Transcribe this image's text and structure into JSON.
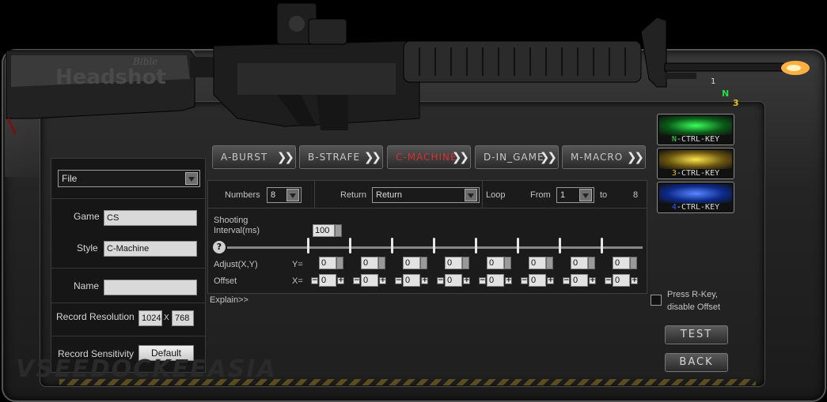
{
  "brand": {
    "stock_text": "Headshot",
    "stock_signature": "Bible",
    "watermark": "VSEEDOCKEEASIA"
  },
  "left": {
    "profile_dropdown": "File",
    "game_label": "Game",
    "game_value": "CS",
    "style_label": "Style",
    "style_value": "C-Machine",
    "name_label": "Name",
    "name_value": "",
    "resolution_label": "Record Resolution",
    "res_w": "1024",
    "res_x": "X",
    "res_h": "768",
    "sensitivity_label": "Record Sensitivity",
    "sensitivity_button": "Default"
  },
  "tabs": [
    {
      "label": "A-Burst",
      "active": false
    },
    {
      "label": "B-strafe",
      "active": false
    },
    {
      "label": "C-Machine",
      "active": true
    },
    {
      "label": "D-In_Game",
      "active": false
    },
    {
      "label": "M-Macro",
      "active": false
    }
  ],
  "controls": {
    "numbers_label": "Numbers",
    "numbers_value": "8",
    "return_label": "Return",
    "return_value": "Return",
    "loop_label": "Loop",
    "from_label": "From",
    "from_value": "1",
    "to_label": "to",
    "to_value": "8",
    "interval_label_1": "Shooting",
    "interval_label_2": "Interval(ms)",
    "interval_value": "100",
    "adjust_label": "Adjust(X,Y)",
    "offset_label": "Offset",
    "y_label": "Y=",
    "x_label": "X=",
    "y_values": [
      "0",
      "0",
      "0",
      "0",
      "0",
      "0",
      "0",
      "0"
    ],
    "x_values": [
      "0",
      "0",
      "0",
      "0",
      "0",
      "0",
      "0",
      "0"
    ],
    "explain": "Explain>>"
  },
  "right": {
    "keys": [
      {
        "label": "N-CTRL-KEY",
        "prefix": "N",
        "color": "#22dd44"
      },
      {
        "label": "3-CTRL-KEY",
        "prefix": "3",
        "color": "#e8c020"
      },
      {
        "label": "4-CTRL-KEY",
        "prefix": "4",
        "color": "#2a5cff"
      }
    ],
    "mode_indicators": [
      "1",
      "N",
      "3"
    ],
    "press_rkey_1": "Press R-Key,",
    "press_rkey_2": "disable Offset",
    "test_button": "TEST",
    "back_button": "BACK"
  },
  "icons": {
    "help": "question-icon",
    "tab_chevron": "double-chevron-icon"
  }
}
